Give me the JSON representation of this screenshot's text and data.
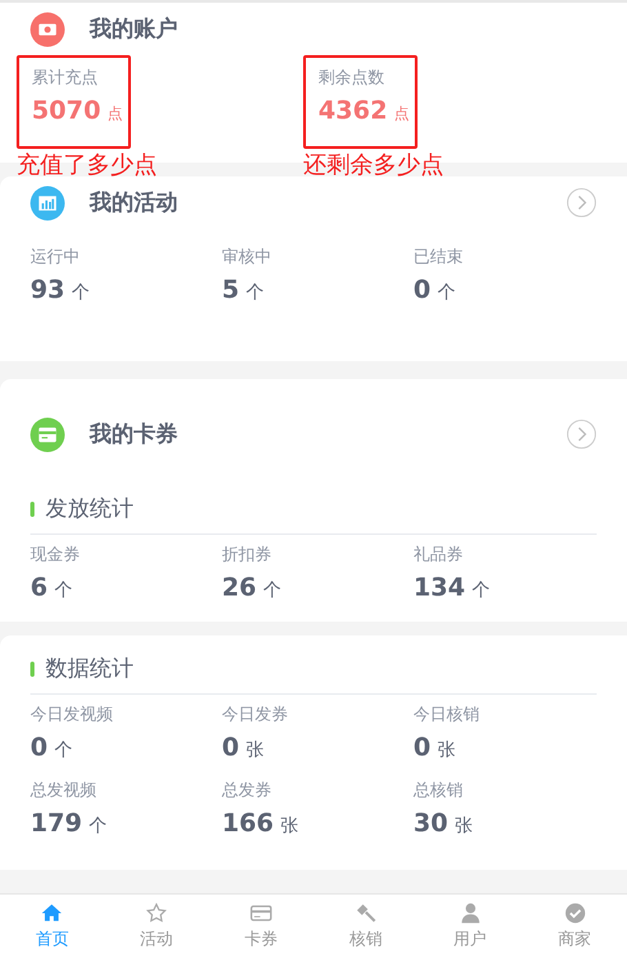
{
  "account": {
    "title": "我的账户",
    "stats": [
      {
        "label": "累计充点",
        "value": "5070",
        "unit": "点",
        "note": "充值了多少点"
      },
      {
        "label": "剩余点数",
        "value": "4362",
        "unit": "点",
        "note": "还剩余多少点"
      }
    ]
  },
  "activity": {
    "title": "我的活动",
    "stats": [
      {
        "label": "运行中",
        "value": "93",
        "unit": "个"
      },
      {
        "label": "审核中",
        "value": "5",
        "unit": "个"
      },
      {
        "label": "已结束",
        "value": "0",
        "unit": "个"
      }
    ]
  },
  "coupons": {
    "title": "我的卡券",
    "issue": {
      "title": "发放统计",
      "stats": [
        {
          "label": "现金券",
          "value": "6",
          "unit": "个"
        },
        {
          "label": "折扣券",
          "value": "26",
          "unit": "个"
        },
        {
          "label": "礼品券",
          "value": "134",
          "unit": "个"
        }
      ]
    }
  },
  "data": {
    "title": "数据统计",
    "stats": [
      {
        "label": "今日发视频",
        "value": "0",
        "unit": "个"
      },
      {
        "label": "今日发券",
        "value": "0",
        "unit": "张"
      },
      {
        "label": "今日核销",
        "value": "0",
        "unit": "张"
      },
      {
        "label": "总发视频",
        "value": "179",
        "unit": "个"
      },
      {
        "label": "总发券",
        "value": "166",
        "unit": "张"
      },
      {
        "label": "总核销",
        "value": "30",
        "unit": "张"
      }
    ]
  },
  "tabbar": [
    {
      "label": "首页",
      "selected": true
    },
    {
      "label": "活动",
      "selected": false
    },
    {
      "label": "卡券",
      "selected": false
    },
    {
      "label": "核销",
      "selected": false
    },
    {
      "label": "用户",
      "selected": false
    },
    {
      "label": "商家",
      "selected": false
    }
  ]
}
